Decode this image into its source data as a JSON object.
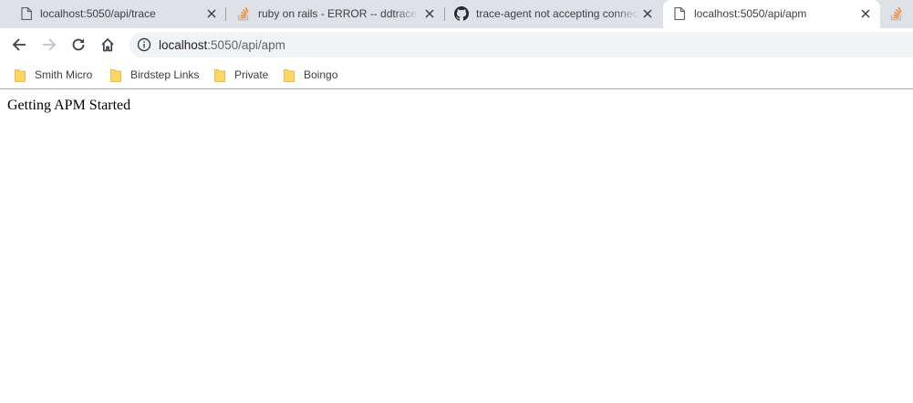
{
  "tabs": [
    {
      "title": "localhost:5050/api/trace",
      "icon": "document-icon",
      "active": false
    },
    {
      "title": "ruby on rails - ERROR -- ddtrace: [ddtrace]",
      "icon": "stackoverflow-icon",
      "active": false
    },
    {
      "title": "trace-agent not accepting connections",
      "icon": "github-icon",
      "active": false
    },
    {
      "title": "localhost:5050/api/apm",
      "icon": "document-icon",
      "active": true
    },
    {
      "title": "",
      "icon": "stackoverflow-icon",
      "active": false
    }
  ],
  "toolbar": {
    "url_host": "localhost",
    "url_path": ":5050/api/apm"
  },
  "bookmarks": [
    {
      "label": "Smith Micro",
      "icon": "folder-icon"
    },
    {
      "label": "Birdstep Links",
      "icon": "folder-icon"
    },
    {
      "label": "Private",
      "icon": "folder-icon"
    },
    {
      "label": "Boingo",
      "icon": "folder-icon"
    }
  ],
  "page": {
    "text": "Getting APM Started"
  },
  "colors": {
    "tabstrip_bg": "#dee1e6",
    "omnibox_bg": "#f1f3f4",
    "folder_fill": "#fdd663",
    "stackoverflow_orange": "#f48024"
  }
}
